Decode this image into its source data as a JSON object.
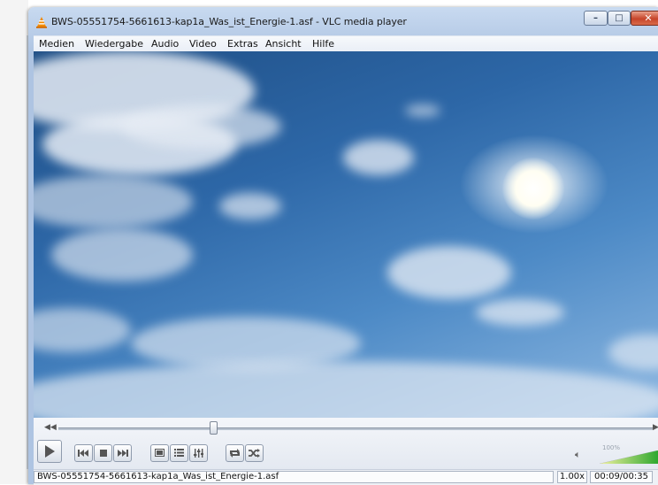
{
  "window": {
    "title": "BWS-05551754-5661613-kap1a_Was_ist_Energie-1.asf - VLC media player",
    "minimize_glyph": "–",
    "maximize_glyph": "□",
    "close_glyph": "✕"
  },
  "menu": {
    "items": [
      "Medien",
      "Wiedergabe",
      "Audio",
      "Video",
      "Extras",
      "Ansicht",
      "Hilfe"
    ]
  },
  "playback": {
    "position_fraction": 0.26
  },
  "volume": {
    "label": "100%",
    "level_fraction": 1.0
  },
  "status": {
    "filename": "BWS-05551754-5661613-kap1a_Was_ist_Energie-1.asf",
    "speed": "1.00x",
    "time": "00:09/00:35"
  },
  "icons": {
    "app": "vlc-cone-icon",
    "play": "play-icon",
    "prev": "previous-icon",
    "stop": "stop-icon",
    "next": "next-icon",
    "fullscreen": "fullscreen-icon",
    "playlist": "playlist-icon",
    "extended": "extended-settings-icon",
    "loop": "loop-icon",
    "shuffle": "shuffle-icon",
    "volume": "speaker-icon"
  },
  "colors": {
    "accent": "#f28a00",
    "volume_start": "#f2f2a0",
    "volume_end": "#2fa82f"
  }
}
